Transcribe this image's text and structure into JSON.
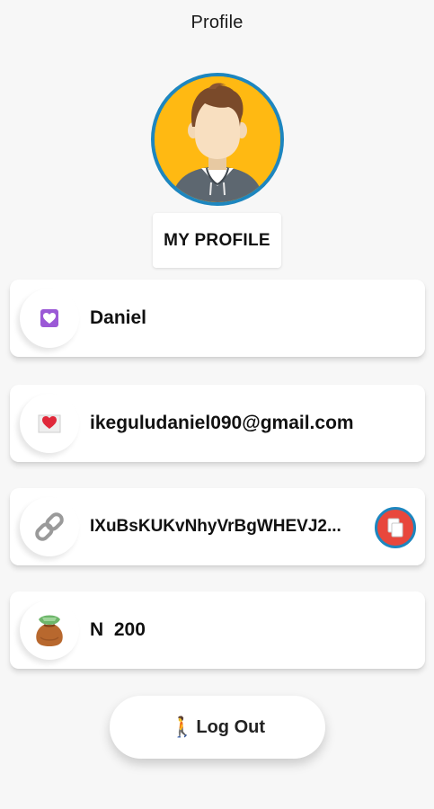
{
  "header": {
    "title": "Profile"
  },
  "avatar": {
    "border_color": "#1d86bf",
    "background_color": "#ffb912"
  },
  "profile_button": {
    "label": "MY PROFILE"
  },
  "cards": [
    {
      "icon": "purple-heart-icon",
      "value": "Daniel"
    },
    {
      "icon": "heart-letter-icon",
      "value": "ikeguludaniel090@gmail.com"
    },
    {
      "icon": "link-icon",
      "value": "IXuBsKUKvNhyVrBgWHEVJ2...",
      "action_icon": "copy-icon"
    },
    {
      "icon": "money-bag-icon",
      "value": "N  200"
    }
  ],
  "logout": {
    "icon": "person-walking-icon",
    "icon_glyph": "🚶",
    "label": "Log Out"
  }
}
